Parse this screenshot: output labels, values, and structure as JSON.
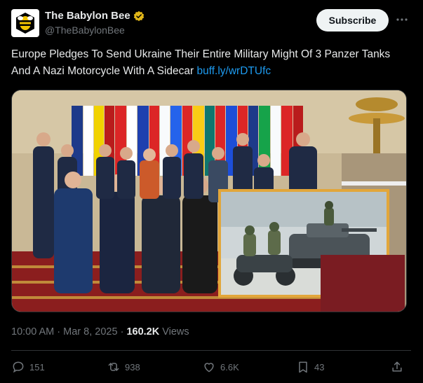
{
  "header": {
    "display_name": "The Babylon Bee",
    "handle": "@TheBabylonBee",
    "subscribe_label": "Subscribe",
    "more_icon": "ellipsis-icon",
    "verified_color": "#e2b719"
  },
  "tweet": {
    "text": "Europe Pledges To Send Ukraine Their Entire Military Might Of 3 Panzer Tanks And A Nazi Motorcycle With A Sidecar ",
    "link": "buff.ly/wrDTUfc"
  },
  "meta": {
    "time": "10:00 AM",
    "sep1": " · ",
    "date": "Mar 8, 2025",
    "sep2": " · ",
    "views_count": "160.2K",
    "views_label": " Views"
  },
  "actions": {
    "replies": "151",
    "reposts": "938",
    "likes": "6.6K",
    "bookmarks": "43"
  },
  "colors": {
    "link": "#1d9bf0",
    "muted": "#71767b",
    "text": "#e7e9ea"
  }
}
